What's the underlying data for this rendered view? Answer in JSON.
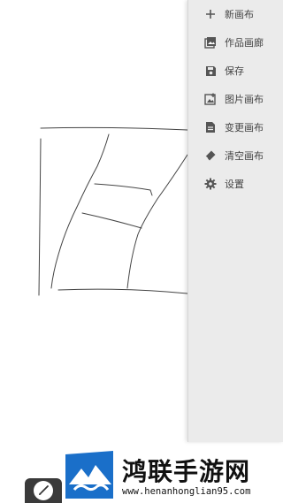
{
  "menu": {
    "items": [
      {
        "label": "新画布",
        "icon": "plus-icon"
      },
      {
        "label": "作品画廊",
        "icon": "gallery-icon"
      },
      {
        "label": "保存",
        "icon": "save-icon"
      },
      {
        "label": "图片画布",
        "icon": "image-canvas-icon"
      },
      {
        "label": "变更画布",
        "icon": "document-icon"
      },
      {
        "label": "清空画布",
        "icon": "eraser-icon"
      },
      {
        "label": "设置",
        "icon": "gear-icon"
      }
    ]
  },
  "toolbar": {
    "icon": "brush-icon"
  },
  "watermark": {
    "title": "鸿联手游网",
    "url": "www.henanhonglian95.com"
  },
  "colors": {
    "menu_bg": "#ebebeb",
    "icon": "#555555",
    "stroke": "#444444",
    "logo_blue": "#1a6fc9"
  }
}
